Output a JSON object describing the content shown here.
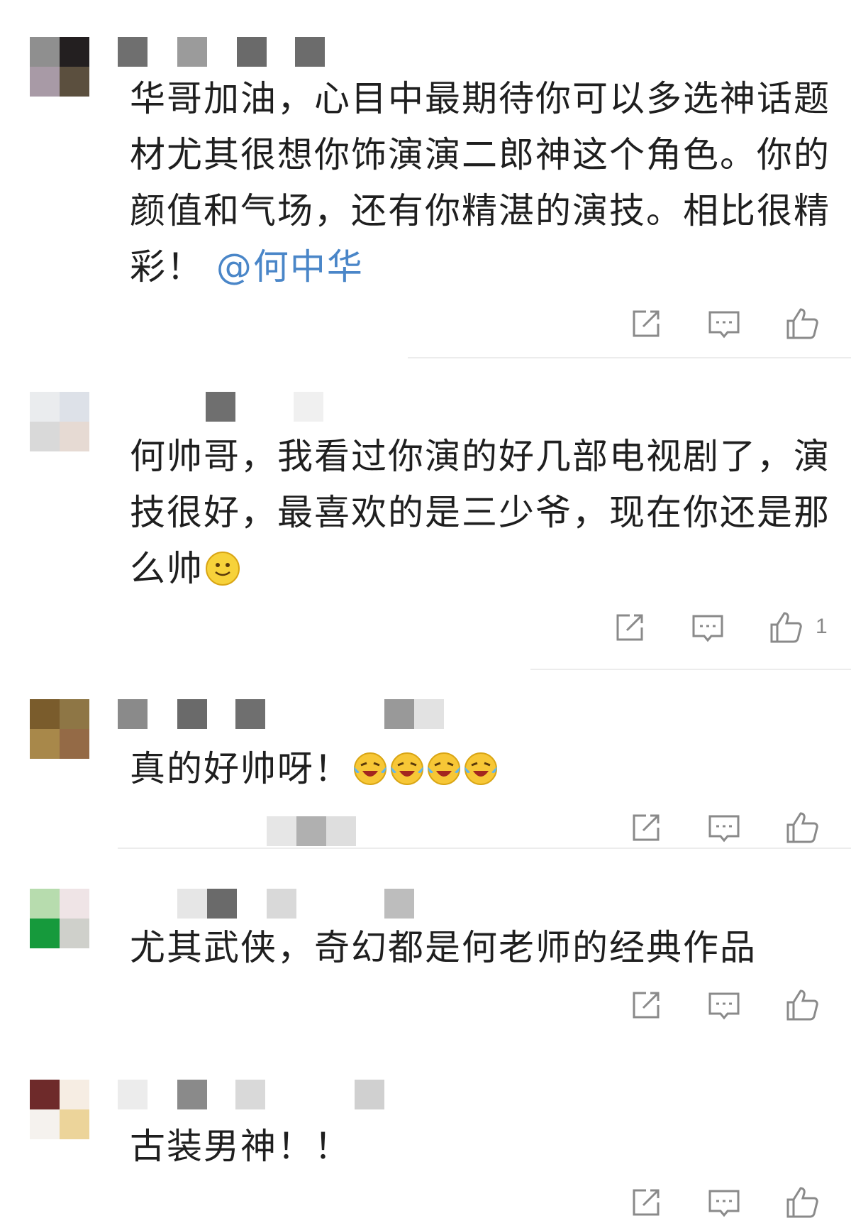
{
  "comments": [
    {
      "text": "华哥加油，心目中最期待你可以多选神话题材尤其很想你饰演演二郎神这个角色。你的颜值和气场，还有你精湛的演技。相比很精彩！",
      "mention": "@何中华",
      "likes": ""
    },
    {
      "text": "何帅哥，我看过你演的好几部电视剧了，演技很好，最喜欢的是三少爷，现在你还是那么帅",
      "emoji": "smile",
      "likes": "1"
    },
    {
      "text": "真的好帅呀！",
      "emoji": "crying-laughing-x4",
      "likes": ""
    },
    {
      "text": "尤其武侠，奇幻都是何老师的经典作品",
      "likes": ""
    },
    {
      "text": "古装男神！！",
      "likes": ""
    }
  ],
  "icons": {
    "share": "share-icon",
    "reply": "reply-icon",
    "like": "like-icon"
  },
  "colors": {
    "mention": "#4a86c8",
    "icon": "#8a8a8a",
    "text": "#1f1f1f"
  }
}
